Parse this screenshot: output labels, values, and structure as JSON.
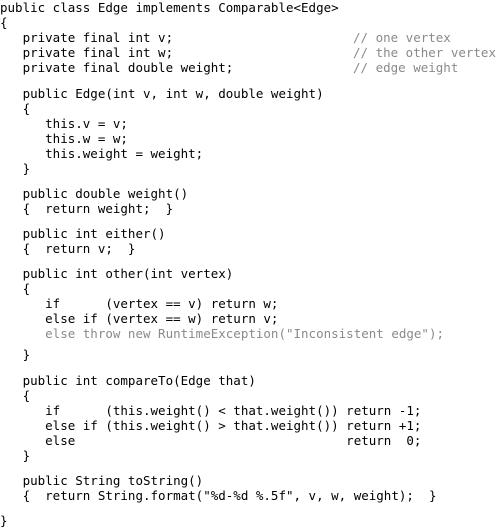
{
  "document": {
    "lines": [
      {
        "code": "public class Edge implements Comparable<Edge>"
      },
      {
        "code": "{"
      },
      {
        "code": "   private final int v;",
        "comment": "// one vertex"
      },
      {
        "code": "   private final int w;",
        "comment": "// the other vertex"
      },
      {
        "code": "   private final double weight;",
        "comment": "// edge weight"
      },
      {
        "code": "   public Edge(int v, int w, double weight)"
      },
      {
        "code": "   {"
      },
      {
        "code": "      this.v = v;"
      },
      {
        "code": "      this.w = w;"
      },
      {
        "code": "      this.weight = weight;"
      },
      {
        "code": "   }"
      },
      {
        "code": "   public double weight()"
      },
      {
        "code": "   {  return weight;  }"
      },
      {
        "code": "   public int either()"
      },
      {
        "code": "   {  return v;  }"
      },
      {
        "code": "   public int other(int vertex)"
      },
      {
        "code": "   {"
      },
      {
        "code": "      if      (vertex == v) return w;"
      },
      {
        "code": "      else if (vertex == w) return v;"
      },
      {
        "code": "",
        "comment": "      else throw new RuntimeException(\"Inconsistent edge\");"
      },
      {
        "code": "   }"
      },
      {
        "code": "   public int compareTo(Edge that)"
      },
      {
        "code": "   {"
      },
      {
        "code": "      if      (this.weight() < that.weight()) return -1;"
      },
      {
        "code": "      else if (this.weight() > that.weight()) return +1;"
      },
      {
        "code": "      else                                    return  0;"
      },
      {
        "code": "   }"
      },
      {
        "code": "   public String toString()"
      },
      {
        "code": "   {  return String.format(\"%d-%d %.5f\", v, w, weight);  }"
      },
      {
        "code": "}"
      }
    ]
  }
}
